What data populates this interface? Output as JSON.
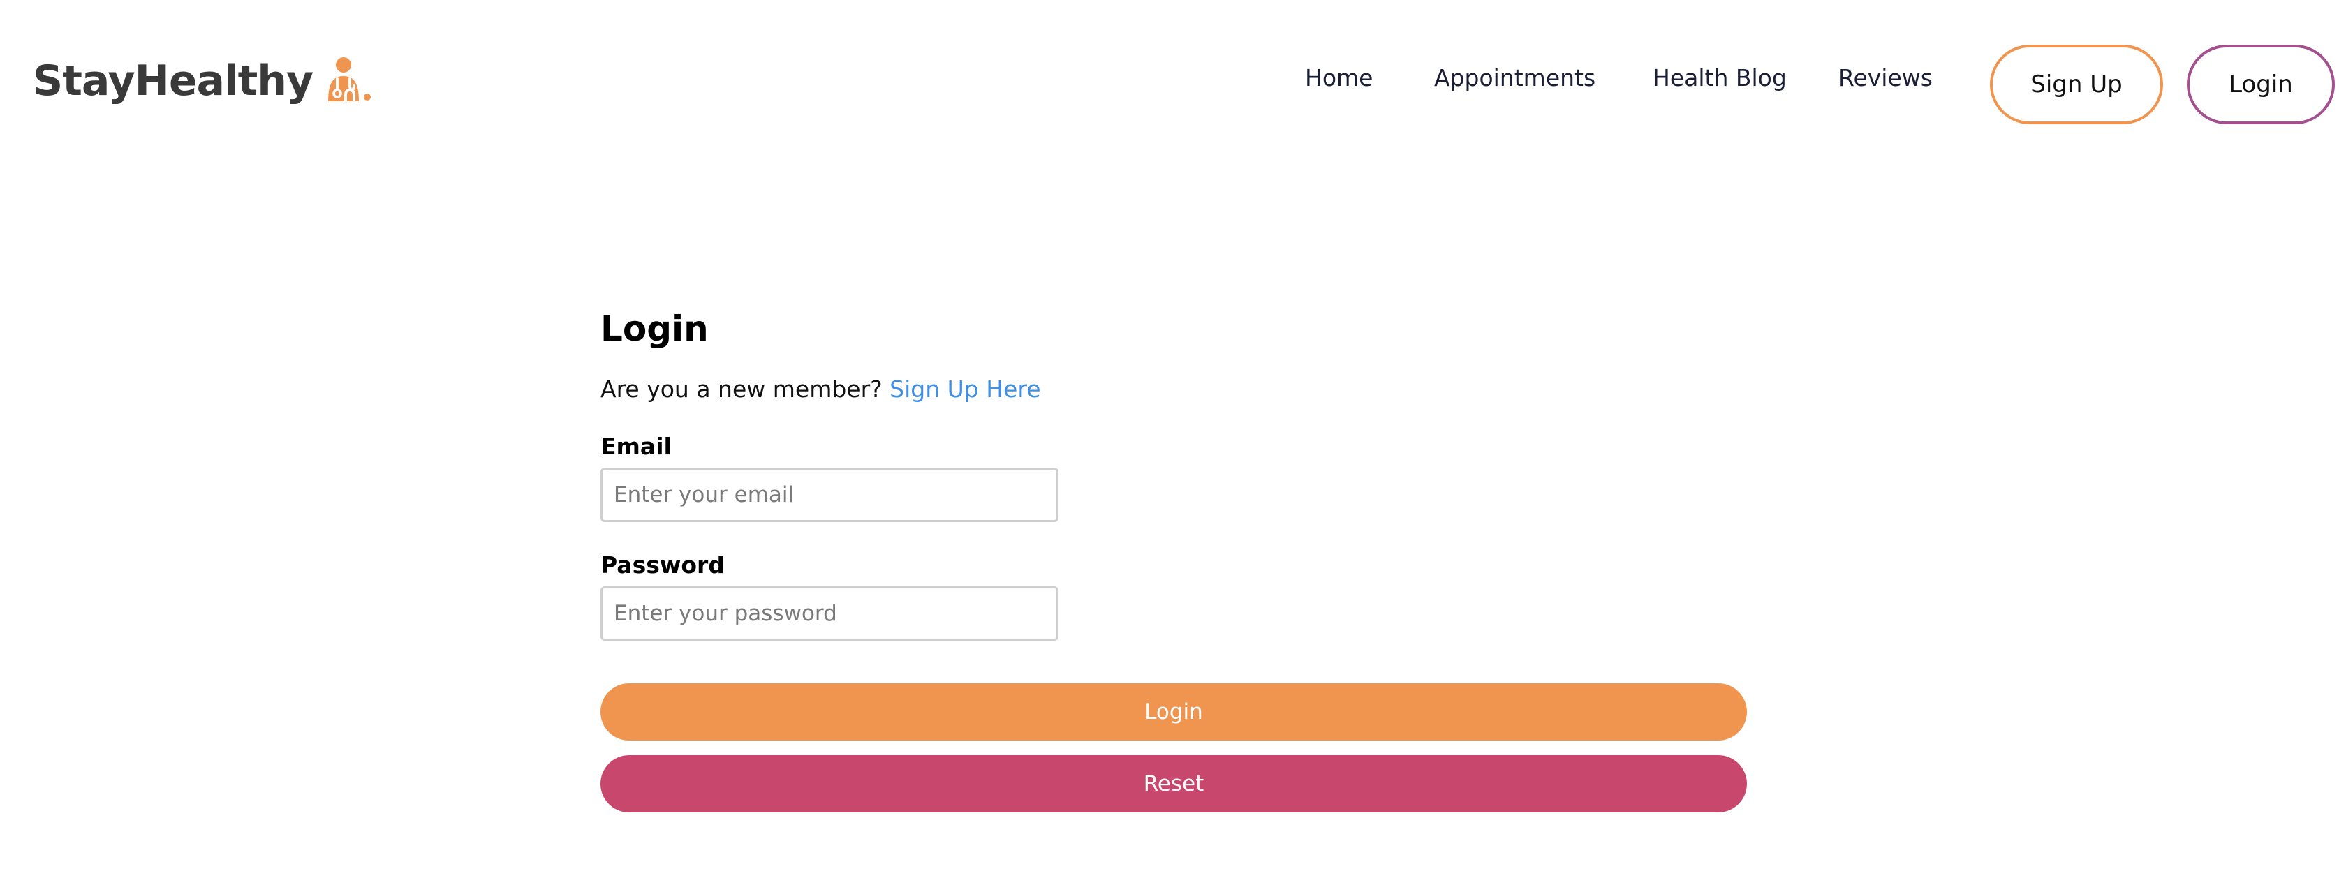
{
  "brand": {
    "name": "StayHealthy",
    "logo_icon": "doctor-icon",
    "logo_color": "#f0954f"
  },
  "nav": {
    "links": [
      {
        "label": "Home"
      },
      {
        "label": "Appointments"
      },
      {
        "label": "Health Blog"
      },
      {
        "label": "Reviews"
      }
    ],
    "signup_label": "Sign Up",
    "login_label": "Login",
    "signup_border_color": "#f0954f",
    "login_border_color": "#a3508f"
  },
  "login_form": {
    "title": "Login",
    "prompt_text": "Are you a new member?",
    "signup_link": "Sign Up Here",
    "email_label": "Email",
    "email_placeholder": "Enter your email",
    "email_value": "",
    "password_label": "Password",
    "password_placeholder": "Enter your password",
    "password_value": "",
    "submit_label": "Login",
    "reset_label": "Reset",
    "submit_color": "#f0954f",
    "reset_color": "#c8476c",
    "link_color": "#3f8fe8"
  }
}
